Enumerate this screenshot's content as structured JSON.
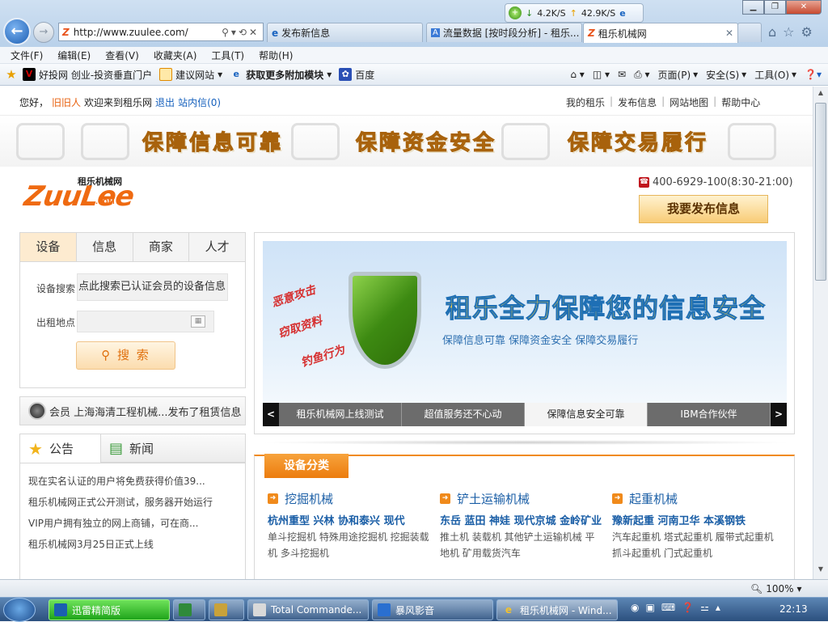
{
  "browser": {
    "address_url": "http://www.zuulee.com/",
    "tabs": [
      {
        "title": "发布新信息",
        "active": false
      },
      {
        "title": "流量数据 [按时段分析] - 租乐...",
        "active": false
      },
      {
        "title": "租乐机械网",
        "active": true
      }
    ],
    "netmeter": {
      "down": "4.2K/S",
      "up": "42.9K/S"
    },
    "menu": [
      "文件(F)",
      "编辑(E)",
      "查看(V)",
      "收藏夹(A)",
      "工具(T)",
      "帮助(H)"
    ],
    "favorites": [
      "好投网 创业-投资垂直门户",
      "建议网站",
      "获取更多附加模块",
      "百度"
    ],
    "commands": [
      "页面(P)",
      "安全(S)",
      "工具(O)"
    ],
    "zoom": "100%"
  },
  "site": {
    "welcome": {
      "hello": "您好，",
      "user": "旧旧人",
      "text": "欢迎来到租乐网",
      "logout": "退出",
      "inbox": "站内信(0)"
    },
    "toplinks": [
      "我的租乐",
      "发布信息",
      "网站地图",
      "帮助中心"
    ],
    "banner": [
      "保障信息可靠",
      "保障资金安全",
      "保障交易履行"
    ],
    "logo": {
      "brand": "租乐机械网",
      "word": "ZuuLee",
      "com": ".COM"
    },
    "phone": "400-6929-100(8:30-21:00)",
    "publish_btn": "我要发布信息",
    "search": {
      "tabs": [
        "设备",
        "信息",
        "商家",
        "人才"
      ],
      "device_label": "设备搜索",
      "device_value": "点此搜索已认证会员的设备信息",
      "location_label": "出租地点",
      "button": "搜 索"
    },
    "notice": "会员 上海海清工程机械...发布了租赁信息",
    "news": {
      "tabs": [
        "公告",
        "新闻"
      ],
      "items": [
        "现在实名认证的用户将免费获得价值39...",
        "租乐机械网正式公开测试，服务器开始运行",
        "VIP用户拥有独立的网上商铺，可在商...",
        "租乐机械网3月25日正式上线"
      ]
    },
    "slider": {
      "title": "租乐全力保障您的信息安全",
      "subtitle": "保障信息可靠  保障资金安全  保障交易履行",
      "threats": [
        "恶意攻击",
        "窃取资料",
        "钓鱼行为"
      ],
      "nav": [
        "租乐机械网上线测试",
        "超值服务还不心动",
        "保障信息安全可靠",
        "IBM合作伙伴"
      ],
      "active_index": 2
    },
    "categories": {
      "tab": "设备分类",
      "columns": [
        {
          "title": "挖掘机械",
          "brands": "杭州重型 兴林 协和泰兴 现代",
          "items": "单斗挖掘机 特殊用途挖掘机 挖掘装载机 多斗挖掘机"
        },
        {
          "title": "铲土运输机械",
          "brands": "东岳 蓝田 神娃 现代京城 金岭矿业",
          "items": "推土机 装载机 其他铲土运输机械 平地机 矿用载货汽车"
        },
        {
          "title": "起重机械",
          "brands": "豫新起重 河南卫华 本溪钢铁",
          "items": "汽车起重机 塔式起重机 履带式起重机 抓斗起重机 门式起重机"
        }
      ]
    }
  },
  "taskbar": {
    "tasks": [
      "迅雷精简版",
      "",
      "",
      "Total Commande...",
      "暴风影音",
      "租乐机械网 - Wind..."
    ],
    "clock": "22:13"
  }
}
